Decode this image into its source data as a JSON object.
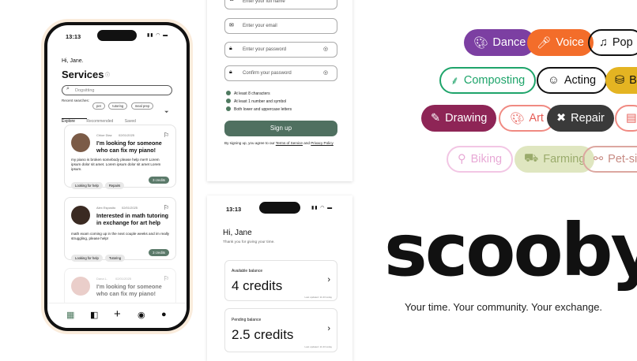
{
  "phone1": {
    "time": "13:13",
    "greeting": "Hi, Jane.",
    "title": "Services",
    "search_placeholder": "Dogsitting",
    "recent_label": "Recent searches:",
    "recent": [
      "pet",
      "tutoring",
      "meal prep"
    ],
    "tabs": [
      "Explore",
      "Recommended",
      "Saved"
    ],
    "cards": [
      {
        "name": "Chloe Diaz",
        "date": "02/01/2025",
        "title": "I'm looking for someone who can fix my piano!",
        "body": "my piano is broken somebody please help me!!! Lorem ipsum dolor sit amet. Lorem ipsum dolor sit amet Lorem ipsum.",
        "tags": [
          "Looking for help",
          "Repairs"
        ],
        "credits": "3 credits"
      },
      {
        "name": "Alex Esposito",
        "date": "02/01/2025",
        "title": "Interested in math tutoring in exchange for art help",
        "body": "math exam coming up in the next couple weeks and im really struggling, please help!",
        "tags": [
          "Looking for help",
          "Tutoring"
        ],
        "credits": "3 credits"
      },
      {
        "name": "Dana L.",
        "date": "02/01/2025",
        "title": "I'm looking for someone who can fix my piano!"
      }
    ]
  },
  "form": {
    "fullname_placeholder": "Enter your full name",
    "email_placeholder": "Enter your email",
    "password_placeholder": "Enter your password",
    "confirm_placeholder": "Confirm your password",
    "checks": [
      "At least 8 characters",
      "At least 1 number and symbol",
      "Both lower and uppercase letters"
    ],
    "signup": "Sign up",
    "terms_prefix": "By signing up, you agree to our ",
    "terms_link": "Terms of Service",
    "terms_and": " and ",
    "privacy_link": "Privacy Policy"
  },
  "phone2": {
    "time": "13:13",
    "greeting": "Hi, Jane",
    "subtitle": "Thank you for giving your time.",
    "available_label": "Available balance",
    "available_value": "4 credits",
    "available_updated": "Last updated: 11:23 today",
    "pending_label": "Pending balance",
    "pending_value": "2.5 credits",
    "pending_updated": "Last updated: 11:23 today"
  },
  "pills": [
    {
      "label": "Dance",
      "icon": "palette-icon"
    },
    {
      "label": "Voice",
      "icon": "microphone-icon"
    },
    {
      "label": "Pop",
      "icon": "music-note-icon"
    },
    {
      "label": "Composting",
      "icon": "trowel-icon"
    },
    {
      "label": "Acting",
      "icon": "mask-icon"
    },
    {
      "label": "Ba",
      "icon": "stamp-icon"
    },
    {
      "label": "Drawing",
      "icon": "brush-icon"
    },
    {
      "label": "Art",
      "icon": "palette-icon"
    },
    {
      "label": "Repair",
      "icon": "tools-icon"
    },
    {
      "label": "Biking",
      "icon": "bike-icon"
    },
    {
      "label": "Farming",
      "icon": "tractor-icon"
    },
    {
      "label": "Pet-sit",
      "icon": "bone-icon"
    }
  ],
  "brand": {
    "logo": "scooby",
    "tagline": "Your time. Your community. Your exchange."
  }
}
